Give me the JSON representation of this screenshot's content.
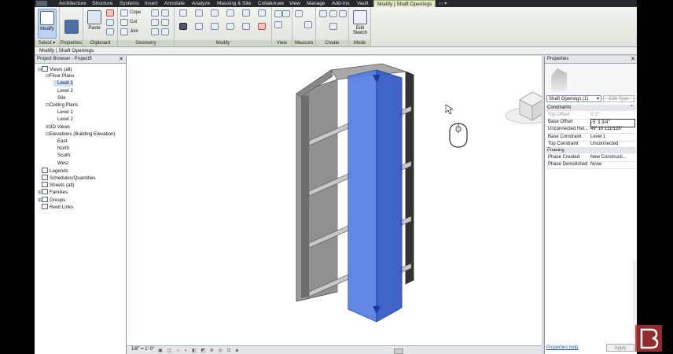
{
  "tabs": [
    "Architecture",
    "Structure",
    "Systems",
    "Insert",
    "Annotate",
    "Analyze",
    "Massing & Site",
    "Collaborate",
    "View",
    "Manage",
    "Add-Ins",
    "Vault",
    "Modify | Shaft Openings"
  ],
  "ribbon": {
    "modify_label": "Modify",
    "properties_label": "Properties",
    "paste_label": "Paste",
    "cope_label": "Cope",
    "cut_label": "Cut",
    "join_label": "Join",
    "edit_sketch_label": "Edit Sketch",
    "panels": {
      "select": "Select ▾",
      "properties": "Properties",
      "clipboard": "Clipboard",
      "geometry": "Geometry",
      "modify": "Modify",
      "view": "View",
      "measure": "Measure",
      "create": "Create",
      "mode": "Mode"
    }
  },
  "context_bar": "Modify | Shaft Openings",
  "browser": {
    "title": "Project Browser - Project5",
    "nodes": [
      {
        "label": "Views (all)",
        "expander": "⊟",
        "level": 0
      },
      {
        "label": "Floor Plans",
        "expander": "⊟",
        "level": 1
      },
      {
        "label": "Level 1",
        "expander": "",
        "level": 2,
        "selected": true
      },
      {
        "label": "Level 2",
        "expander": "",
        "level": 2
      },
      {
        "label": "Site",
        "expander": "",
        "level": 2
      },
      {
        "label": "Ceiling Plans",
        "expander": "⊟",
        "level": 1
      },
      {
        "label": "Level 1",
        "expander": "",
        "level": 2
      },
      {
        "label": "Level 2",
        "expander": "",
        "level": 2
      },
      {
        "label": "3D Views",
        "expander": "⊞",
        "level": 1
      },
      {
        "label": "Elevations (Building Elevation)",
        "expander": "⊟",
        "level": 1
      },
      {
        "label": "East",
        "expander": "",
        "level": 2
      },
      {
        "label": "North",
        "expander": "",
        "level": 2
      },
      {
        "label": "South",
        "expander": "",
        "level": 2
      },
      {
        "label": "West",
        "expander": "",
        "level": 2
      },
      {
        "label": "Legends",
        "expander": "",
        "level": 0
      },
      {
        "label": "Schedules/Quantities",
        "expander": "",
        "level": 0
      },
      {
        "label": "Sheets (all)",
        "expander": "",
        "level": 0
      },
      {
        "label": "Families",
        "expander": "⊞",
        "level": 0
      },
      {
        "label": "Groups",
        "expander": "⊞",
        "level": 0
      },
      {
        "label": "Revit Links",
        "expander": "",
        "level": 0
      }
    ]
  },
  "viewport": {
    "scale": "1/8\" = 1'-0\""
  },
  "properties": {
    "title": "Properties",
    "type_selector": "Shaft Openings (1)",
    "edit_type": "Edit Type",
    "constraints_header": "Constraints",
    "phasing_header": "Phasing",
    "rows": [
      {
        "name": "Top Offset",
        "value": "0' 0\"",
        "dim": true
      },
      {
        "name": "Base Offset",
        "value": "-5' 3 3/4\"",
        "editing": true
      },
      {
        "name": "Unconnected Hei...",
        "value": "49' 10 111/128\""
      },
      {
        "name": "Base Constraint",
        "value": "Level 1"
      },
      {
        "name": "Top Constraint",
        "value": "Unconnected"
      }
    ],
    "phasing_rows": [
      {
        "name": "Phase Created",
        "value": "New Constructi..."
      },
      {
        "name": "Phase Demolished",
        "value": "None"
      }
    ],
    "help_link": "Properties help",
    "apply": "Apply"
  },
  "colors": {
    "shaft_blue": "#3d68d8",
    "wall_gray": "#8c8c8c",
    "active_tab": "#dfe9c8"
  }
}
